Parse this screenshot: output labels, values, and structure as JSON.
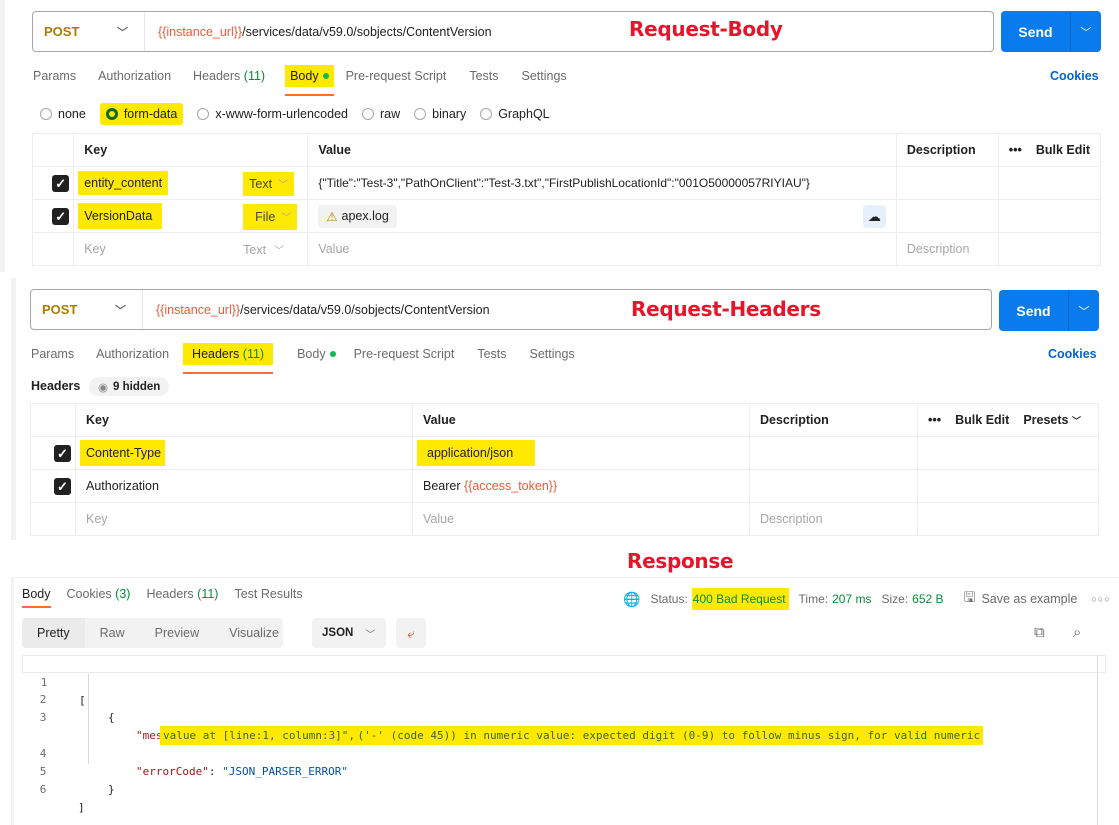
{
  "annotations": {
    "body": "Request-Body",
    "headers": "Request-Headers",
    "response": "Response"
  },
  "request": {
    "method": "POST",
    "url_var": "{{instance_url}}",
    "url_path": "/services/data/v59.0/sobjects/ContentVersion",
    "send_label": "Send",
    "cookies_label": "Cookies"
  },
  "tabs": {
    "params": "Params",
    "authorization": "Authorization",
    "headers": "Headers",
    "headers_count": "(11)",
    "body": "Body",
    "prerequest": "Pre-request Script",
    "tests": "Tests",
    "settings": "Settings"
  },
  "body_modes": {
    "none": "none",
    "form_data": "form-data",
    "urlencoded": "x-www-form-urlencoded",
    "raw": "raw",
    "binary": "binary",
    "graphql": "GraphQL",
    "selected": "form-data"
  },
  "form_table": {
    "columns": {
      "key": "Key",
      "value": "Value",
      "description": "Description",
      "bulk_edit": "Bulk Edit"
    },
    "rows": [
      {
        "checked": true,
        "key": "entity_content",
        "type": "Text",
        "value": "{\"Title\":\"Test-3\",\"PathOnClient\":\"Test-3.txt\",\"FirstPublishLocationId\":\"001O50000057RIYIAU\"}"
      },
      {
        "checked": true,
        "key": "VersionData",
        "type": "File",
        "value": "apex.log"
      }
    ],
    "placeholder": {
      "key": "Key",
      "type": "Text",
      "value": "Value",
      "description": "Description"
    }
  },
  "headers_section": {
    "label": "Headers",
    "hidden": "9 hidden",
    "columns": {
      "key": "Key",
      "value": "Value",
      "description": "Description",
      "bulk_edit": "Bulk Edit",
      "presets": "Presets"
    },
    "rows": [
      {
        "checked": true,
        "key": "Content-Type",
        "value": "application/json"
      },
      {
        "checked": true,
        "key": "Authorization",
        "value_prefix": "Bearer ",
        "value_var": "{{access_token}}"
      }
    ],
    "placeholder": {
      "key": "Key",
      "value": "Value",
      "description": "Description"
    }
  },
  "response": {
    "tabs": {
      "body": "Body",
      "cookies": "Cookies",
      "cookies_count": "(3)",
      "headers": "Headers",
      "headers_count": "(11)",
      "tests": "Test Results"
    },
    "status_label": "Status:",
    "status_value": "400 Bad Request",
    "time_label": "Time:",
    "time_value": "207 ms",
    "size_label": "Size:",
    "size_value": "652 B",
    "save_example": "Save as example",
    "views": {
      "pretty": "Pretty",
      "raw": "Raw",
      "preview": "Preview",
      "visualize": "Visualize"
    },
    "format": "JSON",
    "code": {
      "l1": "[",
      "l2": "{",
      "message_key": "\"message\"",
      "message_val_1": "\"Unexpected character ('-' (code 45)) in numeric value: expected digit (0-9) to follow minus sign, for valid numeric",
      "message_val_2": "value at [line:1, column:3]\",",
      "error_key": "\"errorCode\"",
      "error_val": "\"JSON_PARSER_ERROR\"",
      "l5": "}",
      "l6": "]",
      "line_numbers": [
        "1",
        "2",
        "3",
        "4",
        "5",
        "6"
      ]
    }
  }
}
